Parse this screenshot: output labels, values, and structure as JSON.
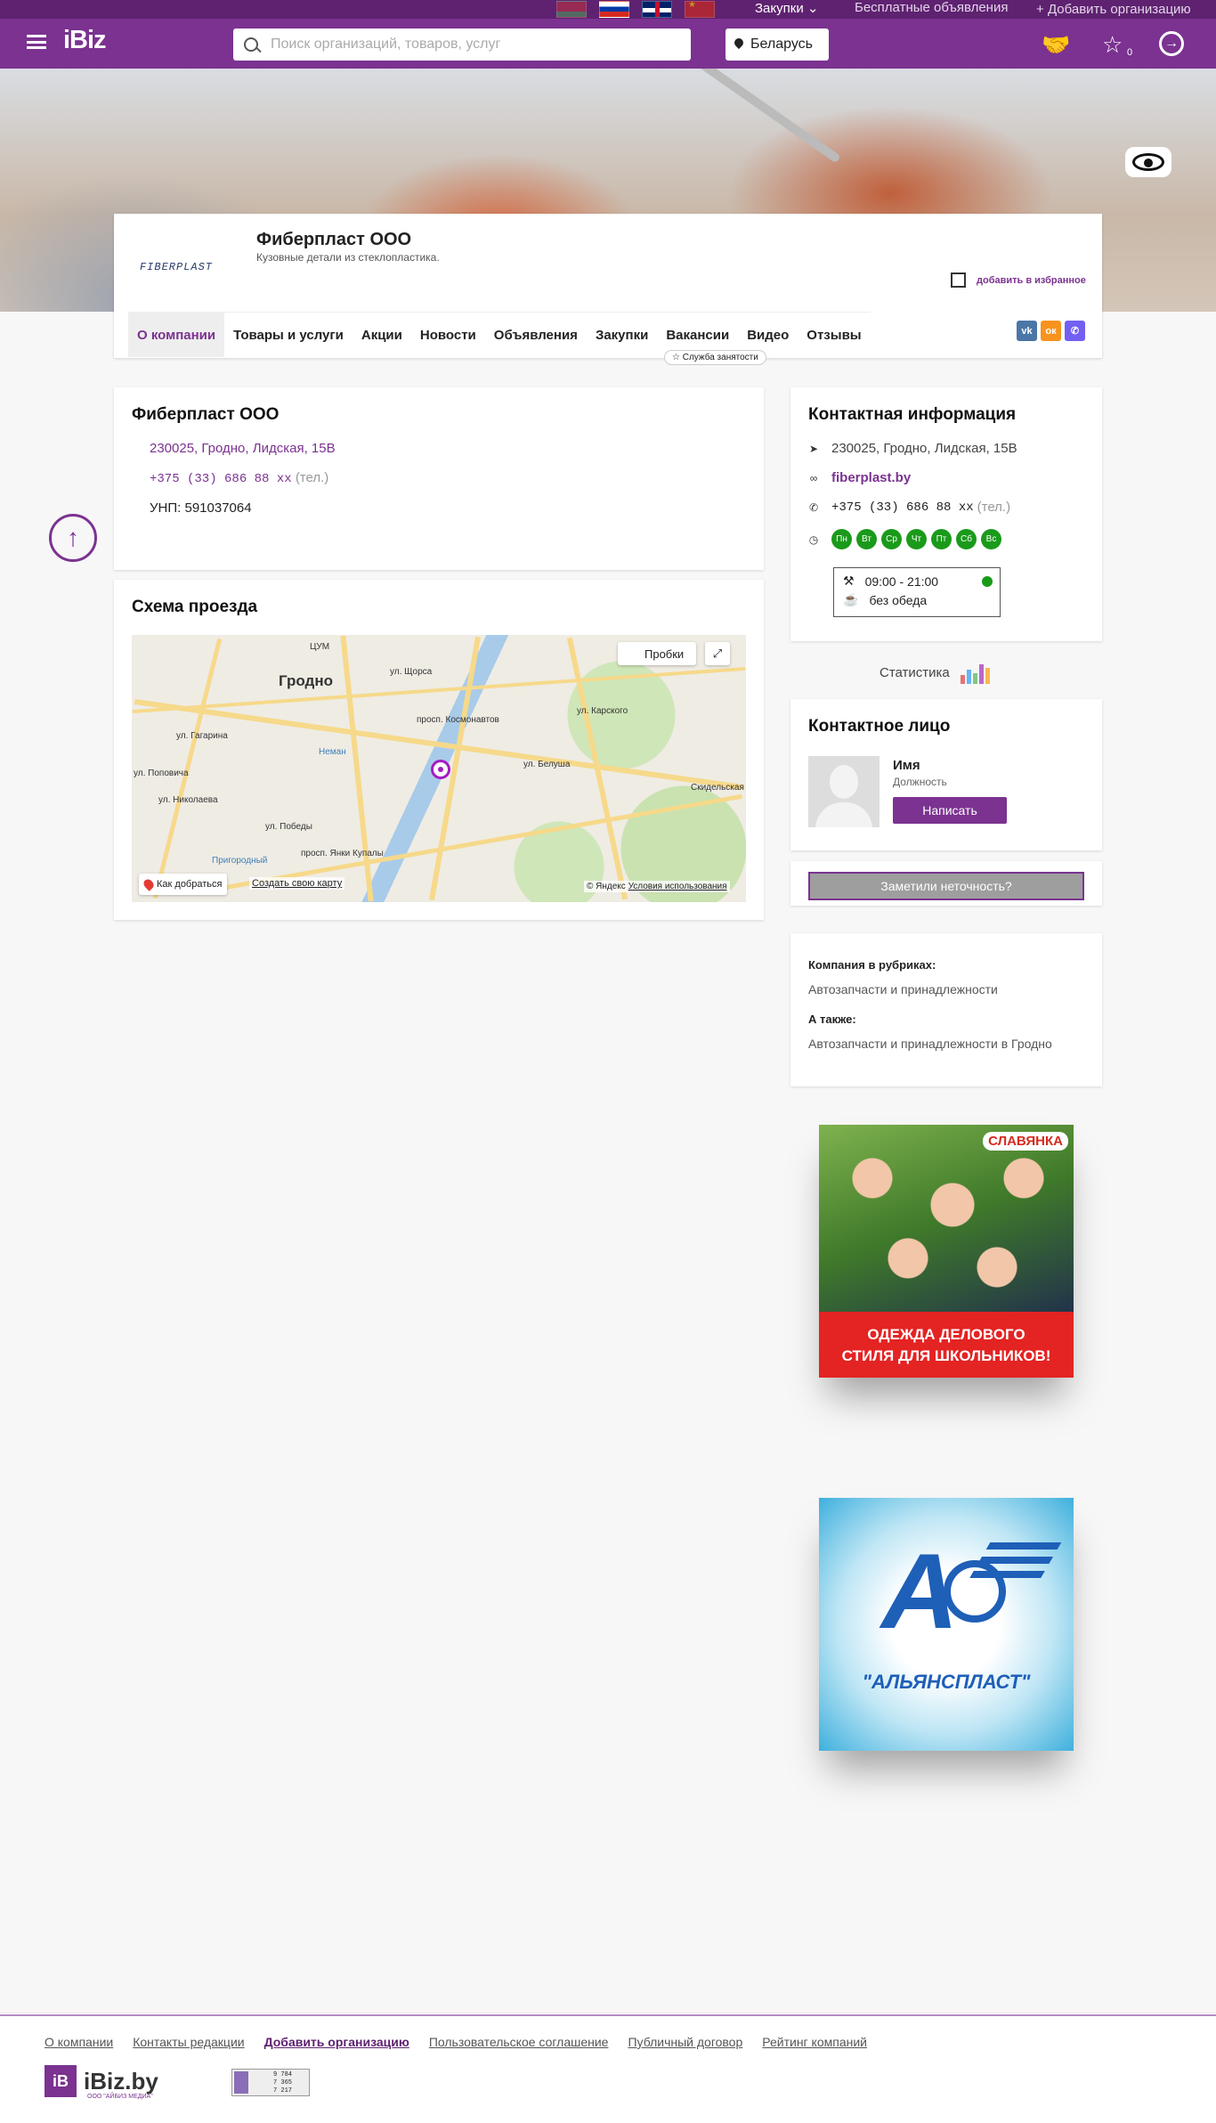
{
  "topbar": {
    "languages": [
      "by",
      "ru",
      "en",
      "cn"
    ],
    "purchases_label": "Закупки",
    "free_ads_label": "Бесплатные объявления",
    "add_org_label": "Добавить организацию"
  },
  "header": {
    "logo": "iBiz",
    "search_placeholder": "Поиск организаций, товаров, услуг",
    "region": "Беларусь",
    "favorites_count": "0"
  },
  "company": {
    "logo_text": "FIBERPLAST",
    "name": "Фиберпласт ООО",
    "description": "Кузовные детали из стеклопластика.",
    "favorite_label": "добавить в избранное",
    "tabs": [
      "О компании",
      "Товары и услуги",
      "Акции",
      "Новости",
      "Объявления",
      "Закупки",
      "Вакансии",
      "Видео",
      "Отзывы"
    ],
    "tab_badge": "Служба занятости"
  },
  "about": {
    "title": "Фиберпласт ООО",
    "address": "230025, Гродно, Лидская, 15В",
    "phone": "+375 (33) 686 88 xx",
    "phone_note": "(тел.)",
    "unp": "УНП: 591037064"
  },
  "map": {
    "title": "Схема проезда",
    "city": "Гродно",
    "traffic_label": "Пробки",
    "route_label": "Как добраться",
    "create_label": "Создать свою карту",
    "copyright": "© Яндекс",
    "terms": "Условия использования",
    "labels": [
      "ЦУМ",
      "ул. Щорса",
      "просп. Космонавтов",
      "ул. Гагарина",
      "ул. Белуша",
      "ул. Карского",
      "ул. Николаева",
      "ул. Победы",
      "Пригородный",
      "просп. Янки Купалы",
      "Скидельская",
      "ул. Поповича",
      "Неман"
    ]
  },
  "contact": {
    "title": "Контактная информация",
    "address": "230025, Гродно, Лидская, 15В",
    "website": "fiberplast.by",
    "phone": "+375 (33) 686 88 xx",
    "phone_note": "(тел.)",
    "days": [
      "Пн",
      "Вт",
      "Ср",
      "Чт",
      "Пт",
      "Сб",
      "Вс"
    ],
    "hours": "09:00 - 21:00",
    "lunch": "без обеда"
  },
  "stats_label": "Статистика",
  "person": {
    "title": "Контактное лицо",
    "name": "Имя",
    "position": "Должность",
    "write_label": "Написать"
  },
  "inaccuracy_label": "Заметили неточность?",
  "rubrics": {
    "title1": "Компания в рубриках:",
    "value1": "Автозапчасти и принадлежности",
    "title2": "А также:",
    "value2": "Автозапчасти и принадлежности в Гродно"
  },
  "ads": {
    "ad1_brand": "СЛАВЯНКА",
    "ad1_slogan_line1": "ОДЕЖДА ДЕЛОВОГО",
    "ad1_slogan_line2": "СТИЛЯ ДЛЯ ШКОЛЬНИКОВ!",
    "ad2_name": "\"АЛЬЯНСПЛАСТ\""
  },
  "footer": {
    "links": [
      "О компании",
      "Контакты редакции",
      "Добавить организацию",
      "Пользовательское соглашение",
      "Публичный договор",
      "Рейтинг компаний"
    ],
    "logo_box": "iB",
    "logo_text": "iBiz.by",
    "logo_sub": "ООО \"АЙБИЗ МЕДИА\"",
    "counter": [
      "9 784",
      "7 365",
      "7 217"
    ]
  },
  "colors": {
    "brand": "#7b3290",
    "brand_dark": "#5e2270",
    "open": "#1a9a1a"
  }
}
